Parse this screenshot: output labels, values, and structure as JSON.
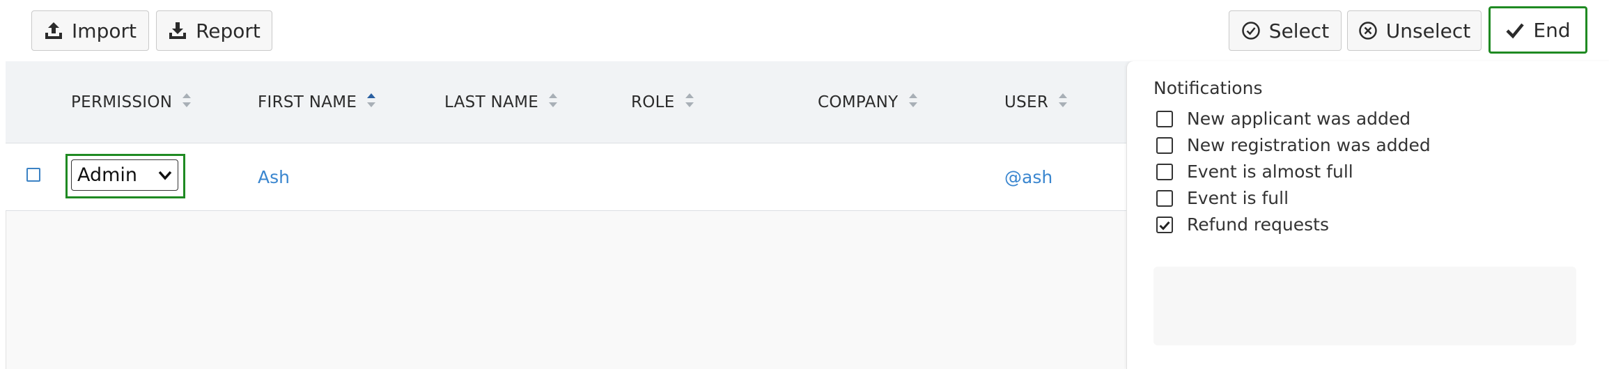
{
  "toolbar": {
    "import_label": "Import",
    "report_label": "Report",
    "select_label": "Select",
    "unselect_label": "Unselect",
    "end_label": "End"
  },
  "table": {
    "columns": [
      "PERMISSION",
      "FIRST NAME",
      "LAST NAME",
      "ROLE",
      "COMPANY",
      "USER"
    ],
    "sorted_column": "FIRST NAME",
    "rows": [
      {
        "permission": "Admin",
        "first_name": "Ash",
        "last_name": "",
        "role": "",
        "company": "",
        "user": "@ash"
      }
    ]
  },
  "notifications": {
    "title": "Notifications",
    "items": [
      {
        "label": "New applicant was added",
        "checked": false
      },
      {
        "label": "New registration was added",
        "checked": false
      },
      {
        "label": "Event is almost full",
        "checked": false
      },
      {
        "label": "Event is full",
        "checked": false
      },
      {
        "label": "Refund requests",
        "checked": true
      }
    ]
  },
  "colors": {
    "accent_green": "#1f8a22",
    "link_blue": "#3a86cf",
    "sort_active": "#2a5fa0"
  }
}
